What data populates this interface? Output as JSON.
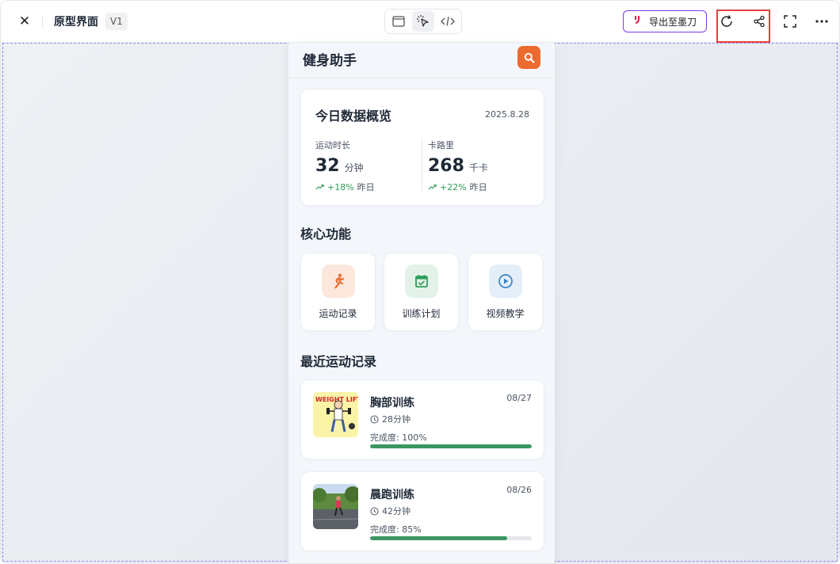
{
  "topbar": {
    "title": "原型界面",
    "version": "V1",
    "export_label": "导出至墨刀",
    "export_logo": "ᕦ"
  },
  "app": {
    "title": "健身助手",
    "overview": {
      "title": "今日数据概览",
      "date": "2025.8.28",
      "metrics": [
        {
          "label": "运动时长",
          "value": "32",
          "unit": "分钟",
          "change": "+18%",
          "change_suffix": "昨日"
        },
        {
          "label": "卡路里",
          "value": "268",
          "unit": "千卡",
          "change": "+22%",
          "change_suffix": "昨日"
        }
      ]
    },
    "features_title": "核心功能",
    "features": [
      {
        "label": "运动记录",
        "icon": "running-icon",
        "color": "#ed6a2e",
        "bg": "#fbe7dc"
      },
      {
        "label": "训练计划",
        "icon": "calendar-check-icon",
        "color": "#2f9d5a",
        "bg": "#e2f2e8"
      },
      {
        "label": "视频教学",
        "icon": "play-circle-icon",
        "color": "#3b82c4",
        "bg": "#e4eef8"
      }
    ],
    "records_title": "最近运动记录",
    "records": [
      {
        "title": "胸部训练",
        "date": "08/27",
        "duration": "28分钟",
        "progress_label": "完成度: 100%",
        "progress": 100,
        "thumb": "weight-lifting-image",
        "thumb_text": "WEIGHT LIFT"
      },
      {
        "title": "晨跑训练",
        "date": "08/26",
        "duration": "42分钟",
        "progress_label": "完成度: 85%",
        "progress": 85,
        "thumb": "running-photo"
      }
    ]
  },
  "colors": {
    "accent": "#ed6a2e",
    "success": "#2f9d5a",
    "progress": "#3c9661",
    "highlight": "#e53e3e",
    "export_border": "#7c3aed"
  }
}
